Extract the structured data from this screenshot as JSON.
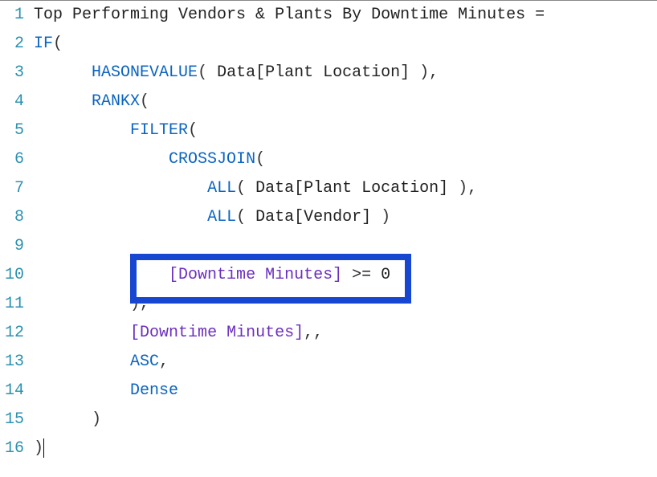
{
  "editor": {
    "lineCount": 16,
    "lines": {
      "l1": {
        "text": "Top Performing Vendors & Plants By Downtime Minutes ="
      },
      "l2": {
        "kw": "IF",
        "open": "("
      },
      "l3": {
        "indent": "      ",
        "fn": "HASONEVALUE",
        "args_open": "( ",
        "col": "Data[Plant Location]",
        "args_close": " ),"
      },
      "l4": {
        "indent": "      ",
        "fn": "RANKX",
        "open": "("
      },
      "l5": {
        "indent": "          ",
        "fn": "FILTER",
        "open": "("
      },
      "l6": {
        "indent": "              ",
        "fn": "CROSSJOIN",
        "open": "("
      },
      "l7": {
        "indent": "                  ",
        "fn": "ALL",
        "args_open": "( ",
        "col": "Data[Plant Location]",
        "args_close": " ),"
      },
      "l8": {
        "indent": "                  ",
        "fn": "ALL",
        "args_open": "( ",
        "col": "Data[Vendor]",
        "args_close": " )"
      },
      "l9": {
        "indent": "              "
      },
      "l10": {
        "indent": "              ",
        "measure": "[Downtime Minutes]",
        "op": " >= ",
        "num": "0"
      },
      "l11": {
        "indent": "          ",
        "close": "),"
      },
      "l12": {
        "indent": "          ",
        "measure": "[Downtime Minutes]",
        "trail": ",,"
      },
      "l13": {
        "indent": "          ",
        "enumc": "ASC",
        "trail": ","
      },
      "l14": {
        "indent": "          ",
        "enumc": "Dense"
      },
      "l15": {
        "indent": "      ",
        "close": ")"
      },
      "l16": {
        "close": ")"
      }
    }
  },
  "linenums": [
    "1",
    "2",
    "3",
    "4",
    "5",
    "6",
    "7",
    "8",
    "9",
    "10",
    "11",
    "12",
    "13",
    "14",
    "15",
    "16"
  ]
}
